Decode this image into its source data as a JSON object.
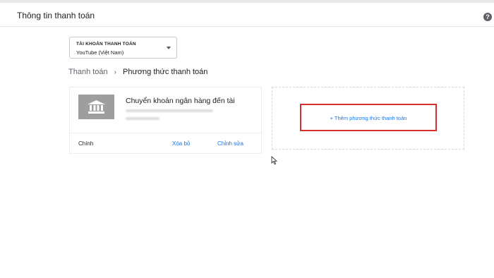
{
  "header": {
    "title": "Thông tin thanh toán",
    "help_icon": "help-circle-icon"
  },
  "account": {
    "label": "TÀI KHOẢN THANH TOÁN",
    "value": "YouTube (Việt Nam)",
    "dropdown_icon": "chevron-down-icon"
  },
  "breadcrumb": {
    "parent": "Thanh toán",
    "separator": "›",
    "current": "Phương thức thanh toán"
  },
  "payment_method": {
    "icon": "bank-icon",
    "title": "Chuyển khoản ngân hàng đến tài",
    "primary_label": "Chính",
    "remove_label": "Xóa bỏ",
    "edit_label": "Chỉnh sửa"
  },
  "add_method": {
    "label": "+ Thêm phương thức thanh toán",
    "highlight_color": "#d32f2f"
  },
  "colors": {
    "link": "#1a73e8",
    "icon_bg": "#9e9e9e"
  }
}
